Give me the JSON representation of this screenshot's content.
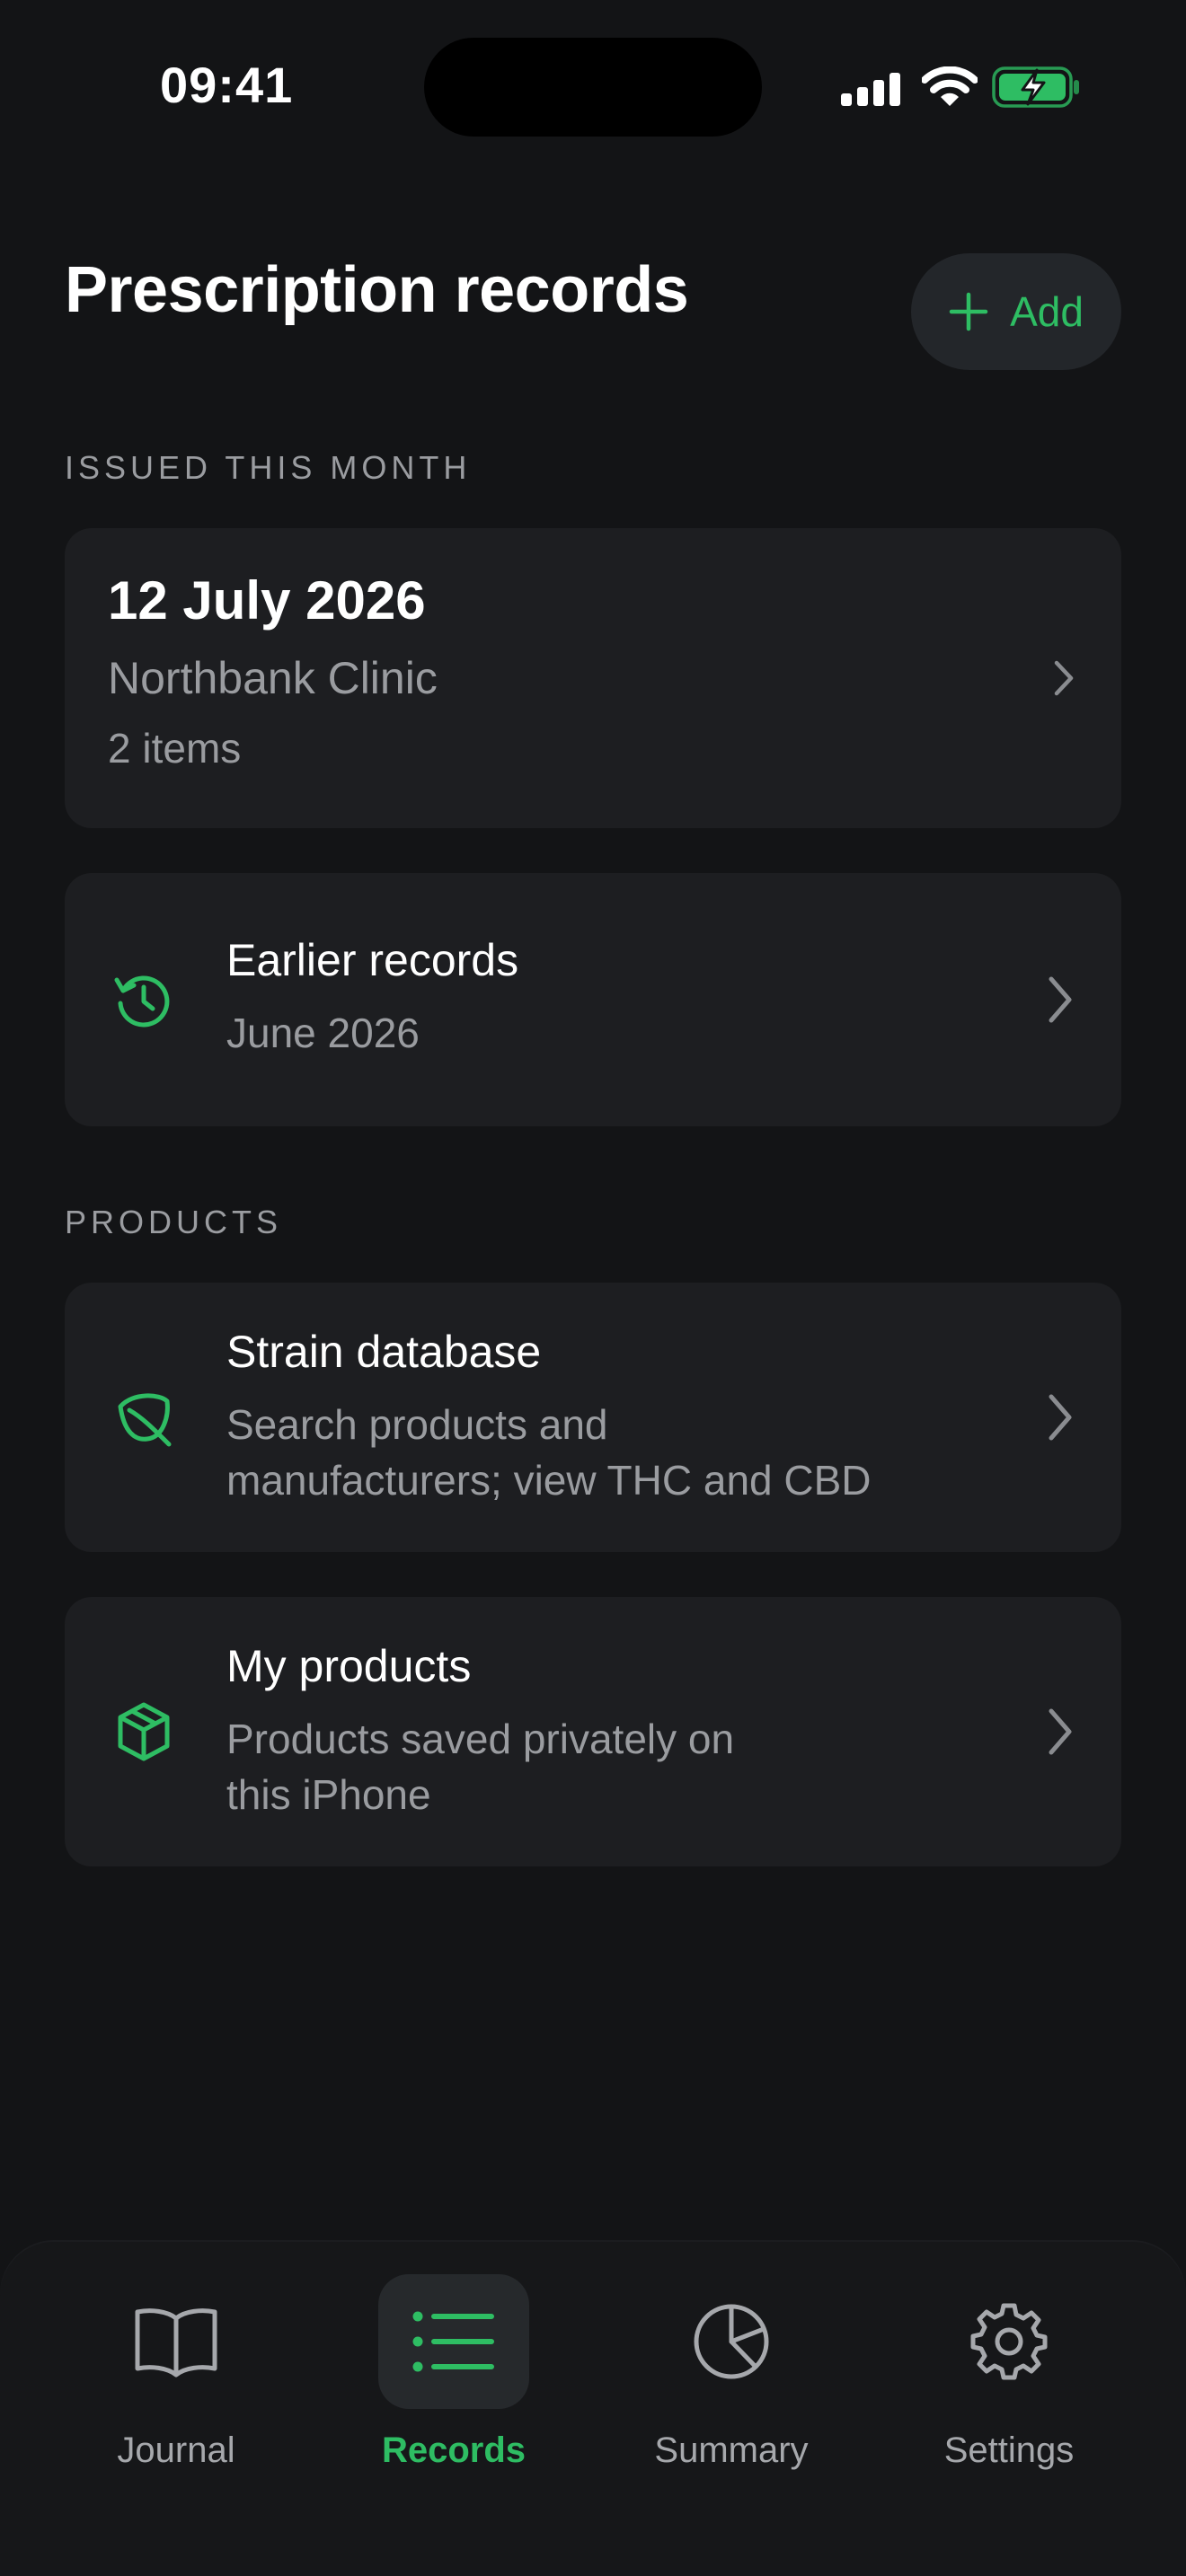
{
  "status_bar": {
    "time": "09:41",
    "icons": [
      "cellular-signal-icon",
      "wifi-icon",
      "battery-charging-icon"
    ]
  },
  "header": {
    "title": "Prescription records",
    "add_button": {
      "icon": "plus-icon",
      "label": "Add"
    }
  },
  "sections": {
    "issued": {
      "header": "ISSUED THIS MONTH",
      "record": {
        "date": "12 July 2026",
        "clinic": "Northbank Clinic",
        "items": "2 items"
      },
      "earlier": {
        "icon": "history-icon",
        "title": "Earlier records",
        "subtitle": "June 2026"
      }
    },
    "products": {
      "header": "PRODUCTS",
      "strain_db": {
        "icon": "leaf-icon",
        "title": "Strain database",
        "subtitle_line1": "Search products and",
        "subtitle_line2": "manufacturers; view THC and CBD"
      },
      "my_products": {
        "icon": "box-icon",
        "title": "My products",
        "subtitle_line1": "Products saved privately on",
        "subtitle_line2": "this iPhone"
      }
    }
  },
  "tab_bar": {
    "tabs": [
      {
        "icon": "book-icon",
        "label": "Journal",
        "active": false
      },
      {
        "icon": "list-icon",
        "label": "Records",
        "active": true
      },
      {
        "icon": "pie-chart-icon",
        "label": "Summary",
        "active": false
      },
      {
        "icon": "gear-icon",
        "label": "Settings",
        "active": false
      }
    ]
  },
  "colors": {
    "background": "#131416",
    "card": "#1d1e21",
    "accent": "#2ebd63",
    "secondary_text": "#9a9ca0"
  }
}
